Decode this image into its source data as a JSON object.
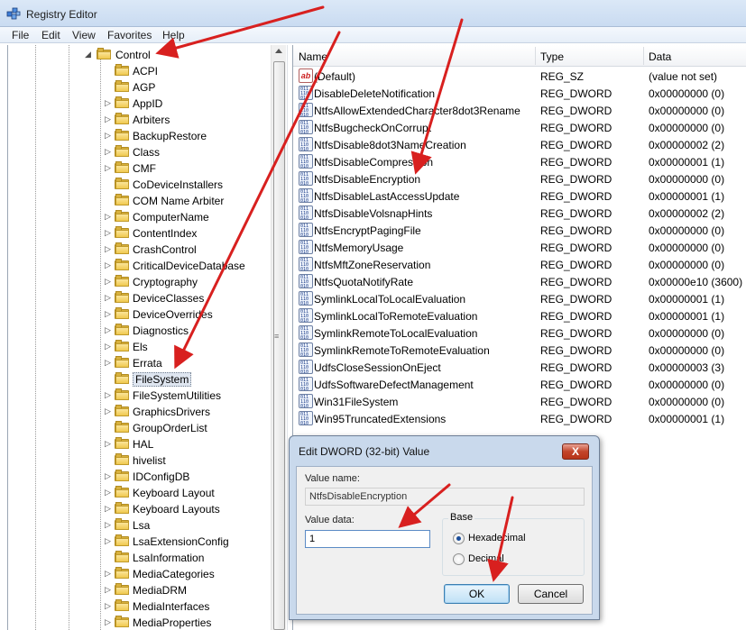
{
  "window": {
    "title": "Registry Editor",
    "icon": "registry-editor-icon"
  },
  "menu": [
    "File",
    "Edit",
    "View",
    "Favorites",
    "Help"
  ],
  "tree": {
    "root": {
      "label": "Control",
      "expander": "◢"
    },
    "children": [
      {
        "label": "ACPI",
        "expander": ""
      },
      {
        "label": "AGP",
        "expander": ""
      },
      {
        "label": "AppID",
        "expander": "▷"
      },
      {
        "label": "Arbiters",
        "expander": "▷"
      },
      {
        "label": "BackupRestore",
        "expander": "▷"
      },
      {
        "label": "Class",
        "expander": "▷"
      },
      {
        "label": "CMF",
        "expander": "▷"
      },
      {
        "label": "CoDeviceInstallers",
        "expander": ""
      },
      {
        "label": "COM Name Arbiter",
        "expander": ""
      },
      {
        "label": "ComputerName",
        "expander": "▷"
      },
      {
        "label": "ContentIndex",
        "expander": "▷"
      },
      {
        "label": "CrashControl",
        "expander": "▷"
      },
      {
        "label": "CriticalDeviceDatabase",
        "expander": "▷"
      },
      {
        "label": "Cryptography",
        "expander": "▷"
      },
      {
        "label": "DeviceClasses",
        "expander": "▷"
      },
      {
        "label": "DeviceOverrides",
        "expander": "▷"
      },
      {
        "label": "Diagnostics",
        "expander": "▷"
      },
      {
        "label": "Els",
        "expander": "▷"
      },
      {
        "label": "Errata",
        "expander": "▷"
      },
      {
        "label": "FileSystem",
        "expander": "",
        "selected": true
      },
      {
        "label": "FileSystemUtilities",
        "expander": "▷"
      },
      {
        "label": "GraphicsDrivers",
        "expander": "▷"
      },
      {
        "label": "GroupOrderList",
        "expander": ""
      },
      {
        "label": "HAL",
        "expander": "▷"
      },
      {
        "label": "hivelist",
        "expander": ""
      },
      {
        "label": "IDConfigDB",
        "expander": "▷"
      },
      {
        "label": "Keyboard Layout",
        "expander": "▷"
      },
      {
        "label": "Keyboard Layouts",
        "expander": "▷"
      },
      {
        "label": "Lsa",
        "expander": "▷"
      },
      {
        "label": "LsaExtensionConfig",
        "expander": "▷"
      },
      {
        "label": "LsaInformation",
        "expander": ""
      },
      {
        "label": "MediaCategories",
        "expander": "▷"
      },
      {
        "label": "MediaDRM",
        "expander": "▷"
      },
      {
        "label": "MediaInterfaces",
        "expander": "▷"
      },
      {
        "label": "MediaProperties",
        "expander": "▷"
      }
    ]
  },
  "list": {
    "columns": {
      "name": "Name",
      "type": "Type",
      "data": "Data"
    },
    "rows": [
      {
        "icon": "string-value-icon",
        "name": "(Default)",
        "type": "REG_SZ",
        "data": "(value not set)"
      },
      {
        "icon": "binary-value-icon",
        "name": "DisableDeleteNotification",
        "type": "REG_DWORD",
        "data": "0x00000000 (0)"
      },
      {
        "icon": "binary-value-icon",
        "name": "NtfsAllowExtendedCharacter8dot3Rename",
        "type": "REG_DWORD",
        "data": "0x00000000 (0)"
      },
      {
        "icon": "binary-value-icon",
        "name": "NtfsBugcheckOnCorrupt",
        "type": "REG_DWORD",
        "data": "0x00000000 (0)"
      },
      {
        "icon": "binary-value-icon",
        "name": "NtfsDisable8dot3NameCreation",
        "type": "REG_DWORD",
        "data": "0x00000002 (2)"
      },
      {
        "icon": "binary-value-icon",
        "name": "NtfsDisableCompression",
        "type": "REG_DWORD",
        "data": "0x00000001 (1)"
      },
      {
        "icon": "binary-value-icon",
        "name": "NtfsDisableEncryption",
        "type": "REG_DWORD",
        "data": "0x00000000 (0)"
      },
      {
        "icon": "binary-value-icon",
        "name": "NtfsDisableLastAccessUpdate",
        "type": "REG_DWORD",
        "data": "0x00000001 (1)"
      },
      {
        "icon": "binary-value-icon",
        "name": "NtfsDisableVolsnapHints",
        "type": "REG_DWORD",
        "data": "0x00000002 (2)"
      },
      {
        "icon": "binary-value-icon",
        "name": "NtfsEncryptPagingFile",
        "type": "REG_DWORD",
        "data": "0x00000000 (0)"
      },
      {
        "icon": "binary-value-icon",
        "name": "NtfsMemoryUsage",
        "type": "REG_DWORD",
        "data": "0x00000000 (0)"
      },
      {
        "icon": "binary-value-icon",
        "name": "NtfsMftZoneReservation",
        "type": "REG_DWORD",
        "data": "0x00000000 (0)"
      },
      {
        "icon": "binary-value-icon",
        "name": "NtfsQuotaNotifyRate",
        "type": "REG_DWORD",
        "data": "0x00000e10 (3600)"
      },
      {
        "icon": "binary-value-icon",
        "name": "SymlinkLocalToLocalEvaluation",
        "type": "REG_DWORD",
        "data": "0x00000001 (1)"
      },
      {
        "icon": "binary-value-icon",
        "name": "SymlinkLocalToRemoteEvaluation",
        "type": "REG_DWORD",
        "data": "0x00000001 (1)"
      },
      {
        "icon": "binary-value-icon",
        "name": "SymlinkRemoteToLocalEvaluation",
        "type": "REG_DWORD",
        "data": "0x00000000 (0)"
      },
      {
        "icon": "binary-value-icon",
        "name": "SymlinkRemoteToRemoteEvaluation",
        "type": "REG_DWORD",
        "data": "0x00000000 (0)"
      },
      {
        "icon": "binary-value-icon",
        "name": "UdfsCloseSessionOnEject",
        "type": "REG_DWORD",
        "data": "0x00000003 (3)"
      },
      {
        "icon": "binary-value-icon",
        "name": "UdfsSoftwareDefectManagement",
        "type": "REG_DWORD",
        "data": "0x00000000 (0)"
      },
      {
        "icon": "binary-value-icon",
        "name": "Win31FileSystem",
        "type": "REG_DWORD",
        "data": "0x00000000 (0)"
      },
      {
        "icon": "binary-value-icon",
        "name": "Win95TruncatedExtensions",
        "type": "REG_DWORD",
        "data": "0x00000001 (1)"
      }
    ]
  },
  "dialog": {
    "title": "Edit DWORD (32-bit) Value",
    "close_label": "X",
    "value_name_label": "Value name:",
    "value_name": "NtfsDisableEncryption",
    "value_data_label": "Value data:",
    "value_data": "1",
    "base_label": "Base",
    "base_options": [
      {
        "label": "Hexadecimal",
        "selected": true
      },
      {
        "label": "Decimal",
        "selected": false
      }
    ],
    "ok_label": "OK",
    "cancel_label": "Cancel"
  },
  "annotation_color": "#d8201f"
}
